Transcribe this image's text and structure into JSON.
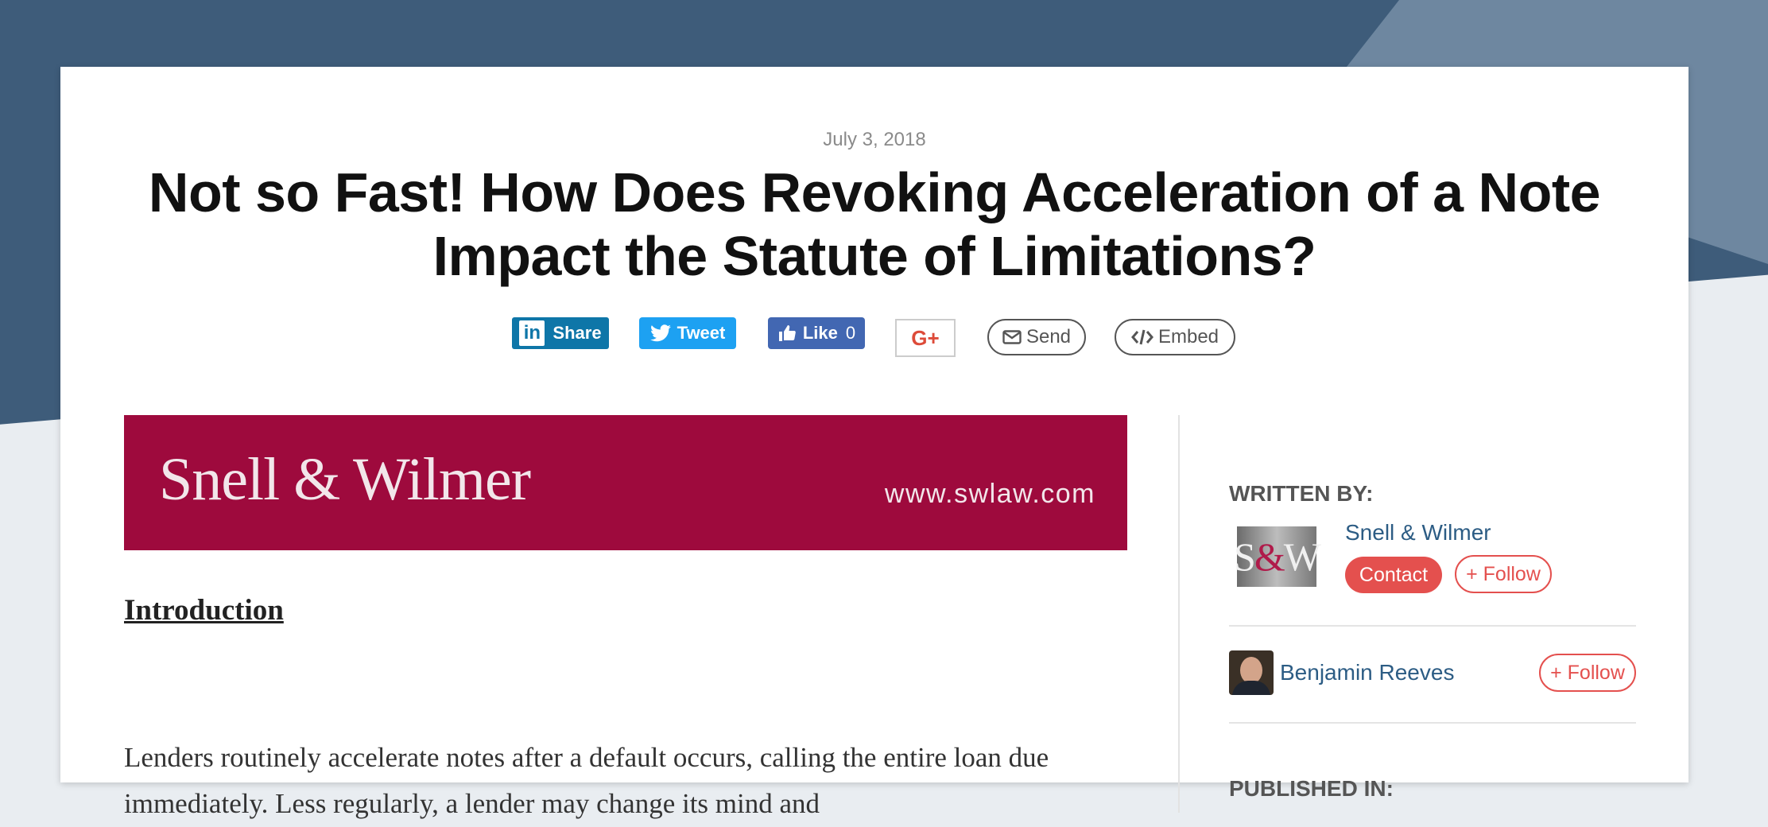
{
  "article": {
    "date": "July 3, 2018",
    "title": "Not so Fast! How Does Revoking Acceleration of a Note Impact the Statute of Limitations?"
  },
  "share": {
    "linkedin_icon": "in",
    "linkedin": "Share",
    "twitter": "Tweet",
    "facebook": "Like",
    "facebook_count": "0",
    "googleplus": "G+",
    "send": "Send",
    "embed": "Embed"
  },
  "banner": {
    "firm": "Snell & Wilmer",
    "url": "www.swlaw.com"
  },
  "content": {
    "heading": "Introduction",
    "paragraph": "Lenders routinely accelerate notes after a default occurs, calling the entire loan due immediately. Less regularly, a lender may change its mind and"
  },
  "sidebar": {
    "written_by_label": "WRITTEN BY:",
    "firm": {
      "logo_text_left": "S",
      "logo_text_amp": "&",
      "logo_text_right": "W",
      "name": "Snell & Wilmer",
      "contact_label": "Contact",
      "follow_label": "+ Follow"
    },
    "author": {
      "name": "Benjamin Reeves",
      "follow_label": "+ Follow"
    },
    "published_in_label": "PUBLISHED IN:"
  },
  "colors": {
    "background": "#3e5c7a",
    "banner": "#9e0a3d",
    "link": "#2c5c84",
    "accent": "#e4504e"
  },
  "icons": {
    "linkedin": "linkedin-icon",
    "twitter": "twitter-bird-icon",
    "facebook": "thumbs-up-icon",
    "googleplus": "google-plus-icon",
    "send": "envelope-icon",
    "embed": "code-icon"
  }
}
